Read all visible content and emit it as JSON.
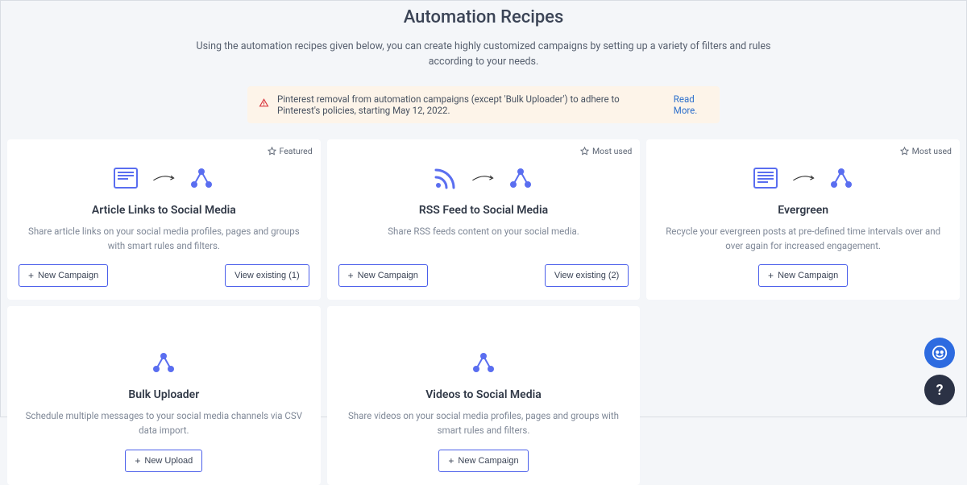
{
  "page": {
    "title": "Automation Recipes",
    "subtitle": "Using the automation recipes given below, you can create highly customized campaigns by setting up a variety of filters and rules according to your needs."
  },
  "alert": {
    "text": "Pinterest removal from automation campaigns (except 'Bulk Uploader') to adhere to Pinterest's policies, starting May 12, 2022.",
    "link_text": "Read More."
  },
  "badges": {
    "featured": "Featured",
    "most_used": "Most used"
  },
  "buttons": {
    "new_campaign": "New Campaign",
    "new_upload": "New Upload",
    "view_existing_1": "View existing (1)",
    "view_existing_2": "View existing (2)"
  },
  "cards": {
    "article": {
      "title": "Article Links to Social Media",
      "desc": "Share article links on your social media profiles, pages and groups with smart rules and filters."
    },
    "rss": {
      "title": "RSS Feed to Social Media",
      "desc": "Share RSS feeds content on your social media."
    },
    "evergreen": {
      "title": "Evergreen",
      "desc": "Recycle your evergreen posts at pre-defined time intervals over and over again for increased engagement."
    },
    "bulk": {
      "title": "Bulk Uploader",
      "desc": "Schedule multiple messages to your social media channels via CSV data import."
    },
    "videos": {
      "title": "Videos to Social Media",
      "desc": "Share videos on your social media profiles, pages and groups with smart rules and filters."
    }
  }
}
